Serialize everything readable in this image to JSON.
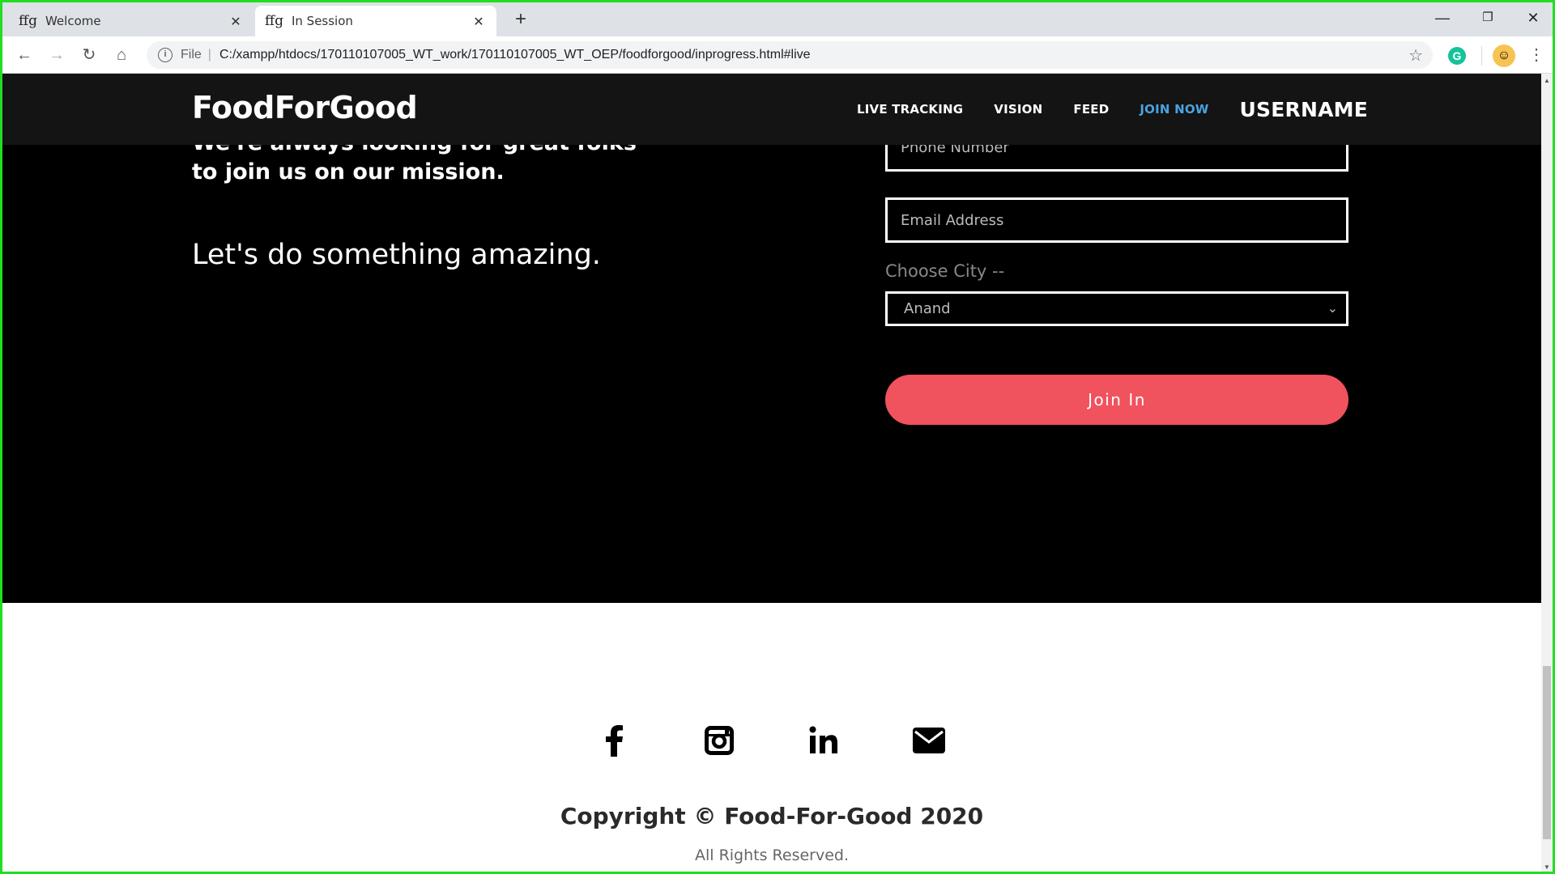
{
  "browser": {
    "tabs": [
      {
        "favicon": "ffg",
        "title": "Welcome"
      },
      {
        "favicon": "ffg",
        "title": "In Session"
      }
    ],
    "address": {
      "scheme": "File",
      "url": "C:/xampp/htdocs/170110107005_WT_work/170110107005_WT_OEP/foodforgood/inprogress.html#live"
    }
  },
  "nav": {
    "brand": "FoodForGood",
    "links": [
      "LIVE TRACKING",
      "VISION",
      "FEED",
      "JOIN NOW"
    ],
    "username": "USERNAME",
    "active_link": "JOIN NOW",
    "active_color": "#4aa3e0"
  },
  "hero": {
    "lead": "We're always looking for great folks to join us on our mission.",
    "tagline": "Let's do something amazing."
  },
  "form": {
    "phone_placeholder": "Phone Number",
    "email_placeholder": "Email Address",
    "city_label": "Choose City --",
    "city_selected": "Anand",
    "submit_label": "Join In",
    "submit_color": "#f0525e"
  },
  "footer": {
    "social_icons": [
      "facebook-icon",
      "instagram-icon",
      "linkedin-icon",
      "mail-icon"
    ],
    "copyright": "Copyright © Food-For-Good 2020",
    "rights": "All Rights Reserved."
  }
}
